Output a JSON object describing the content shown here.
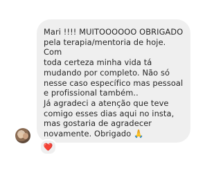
{
  "message": {
    "text": "Mari !!!! MUITOOOOOO OBRIGADO\npela terapia/mentoria de hoje. Com\ntoda certeza minha vida tá\nmudando por completo. Não só\nnesse caso específico mas pessoal\ne profissional também..\nJá agradeci a atenção que teve\ncomigo esses dias aqui no insta,\nmas gostaria de agradecer\nnovamente. Obrigado 🙏"
  },
  "reaction": {
    "emoji": "❤️",
    "color": "#ed3b4e"
  },
  "colors": {
    "bubble": "#efefef",
    "text": "#262626",
    "background": "#ffffff"
  },
  "icons": {
    "avatar": "profile-photo-avatar",
    "reaction": "heart-icon"
  }
}
